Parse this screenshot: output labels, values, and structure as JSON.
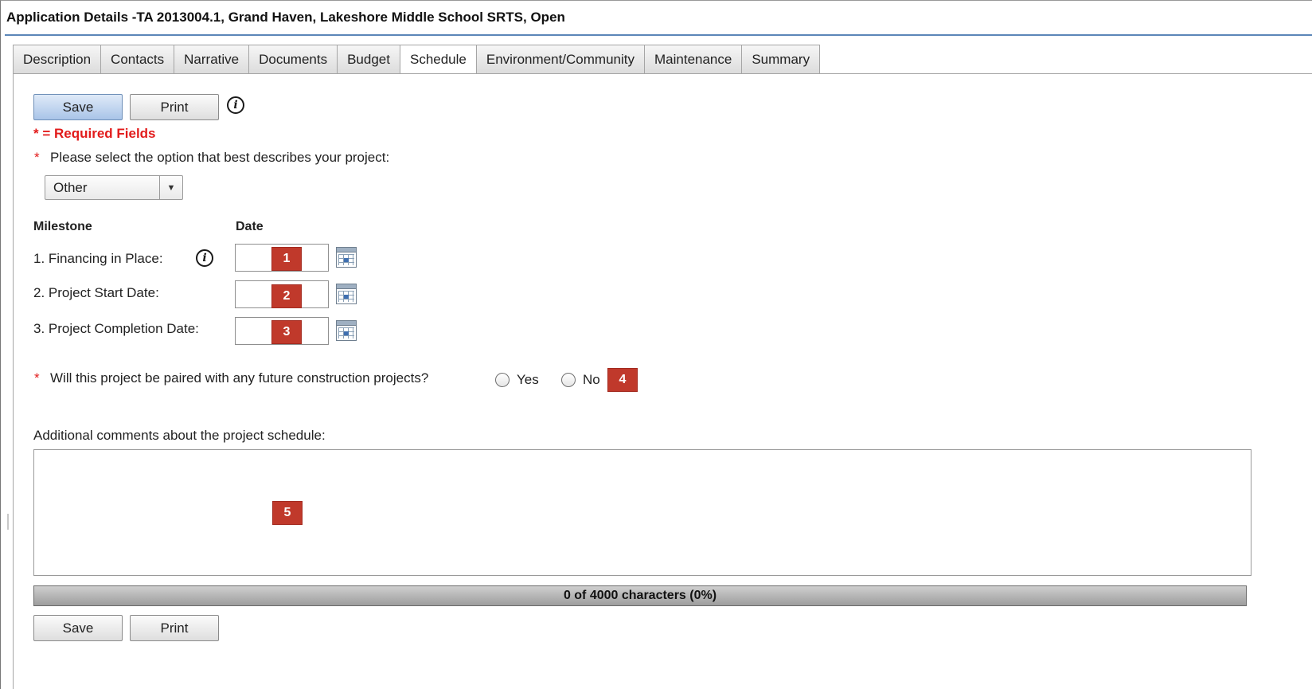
{
  "header": {
    "title": "Application Details -TA 2013004.1, Grand Haven, Lakeshore Middle School SRTS, Open"
  },
  "tabs": [
    {
      "label": "Description"
    },
    {
      "label": "Contacts"
    },
    {
      "label": "Narrative"
    },
    {
      "label": "Documents"
    },
    {
      "label": "Budget"
    },
    {
      "label": "Schedule",
      "active": true
    },
    {
      "label": "Environment/Community"
    },
    {
      "label": "Maintenance"
    },
    {
      "label": "Summary"
    }
  ],
  "toolbar": {
    "save_label": "Save",
    "print_label": "Print",
    "info_icon": "info-icon"
  },
  "required_note": "* = Required Fields",
  "project_option": {
    "asterisk": "*",
    "question": "Please select the option that best describes your project:",
    "selected": "Other"
  },
  "milestones": {
    "header_milestone": "Milestone",
    "header_date": "Date",
    "items": [
      {
        "label": "1. Financing in Place:",
        "value": "",
        "badge": "1"
      },
      {
        "label": "2. Project Start Date:",
        "value": "",
        "badge": "2"
      },
      {
        "label": "3. Project Completion Date:",
        "value": "",
        "badge": "3"
      }
    ]
  },
  "paired_question": {
    "asterisk": "*",
    "text": "Will this project be paired with any future construction projects?",
    "yes_label": "Yes",
    "no_label": "No",
    "badge": "4"
  },
  "comments": {
    "label": "Additional comments about the project schedule:",
    "value": "",
    "badge": "5",
    "counter": "0 of 4000 characters (0%)"
  },
  "footer": {
    "save_label": "Save",
    "print_label": "Print"
  },
  "colors": {
    "required_red": "#e21b1b",
    "badge_red": "#c0392b",
    "title_rule_blue": "#5b86b8"
  }
}
